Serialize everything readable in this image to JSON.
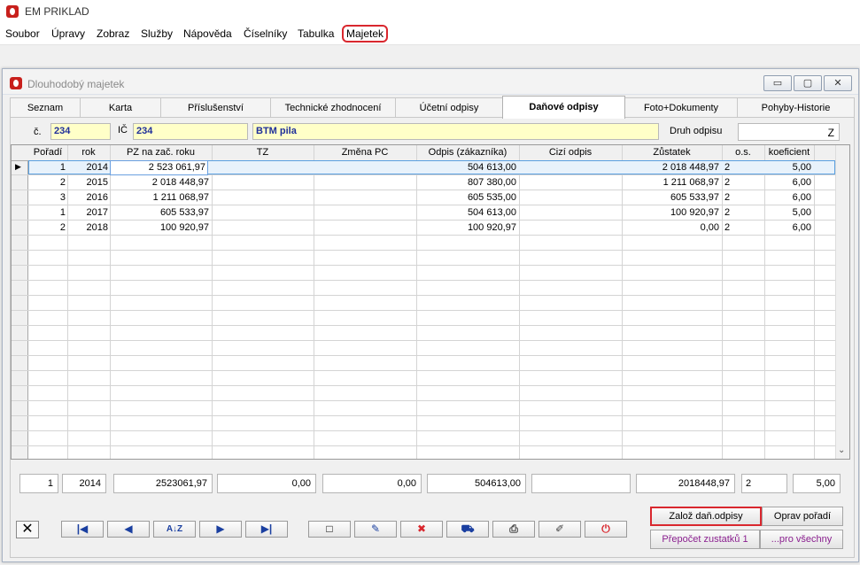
{
  "app": {
    "title": "EM PRIKLAD"
  },
  "menu": [
    "Soubor",
    "Úpravy",
    "Zobraz",
    "Služby",
    "Nápověda",
    "Číselníky",
    "Tabulka",
    "Majetek"
  ],
  "window": {
    "title": "Dlouhodobý majetek",
    "controls": {
      "minimize": "▭",
      "maximize": "▢",
      "close": "✕"
    }
  },
  "tabs": [
    "Seznam",
    "Karta",
    "Příslušenství",
    "Technické zhodnocení",
    "Účetní odpisy",
    "Daňové odpisy",
    "Foto+Dokumenty",
    "Pohyby-Historie"
  ],
  "active_tab": "Daňové odpisy",
  "form": {
    "c_label": "č.",
    "c_value": "234",
    "ic_label": "IČ",
    "ic_value": "234",
    "name_value": "BTM pila",
    "druh_label": "Druh odpisu",
    "druh_value": "Z"
  },
  "table": {
    "columns": [
      "Pořadí",
      "rok",
      "PZ na zač. roku",
      "TZ",
      "Změna PC",
      "Odpis (zákazníka)",
      "Cizí odpis",
      "Zůstatek",
      "o.s.",
      "koeficient"
    ],
    "rows": [
      {
        "poradi": "1",
        "rok": "2014",
        "pz": "2 523 061,97",
        "tz": "",
        "zmena": "",
        "odpis": "504 613,00",
        "cizi": "",
        "zustatek": "2 018 448,97",
        "os": "2",
        "koef": "5,00"
      },
      {
        "poradi": "2",
        "rok": "2015",
        "pz": "2 018 448,97",
        "tz": "",
        "zmena": "",
        "odpis": "807 380,00",
        "cizi": "",
        "zustatek": "1 211 068,97",
        "os": "2",
        "koef": "6,00"
      },
      {
        "poradi": "3",
        "rok": "2016",
        "pz": "1 211 068,97",
        "tz": "",
        "zmena": "",
        "odpis": "605 535,00",
        "cizi": "",
        "zustatek": "605 533,97",
        "os": "2",
        "koef": "6,00"
      },
      {
        "poradi": "1",
        "rok": "2017",
        "pz": "605 533,97",
        "tz": "",
        "zmena": "",
        "odpis": "504 613,00",
        "cizi": "",
        "zustatek": "100 920,97",
        "os": "2",
        "koef": "5,00"
      },
      {
        "poradi": "2",
        "rok": "2018",
        "pz": "100 920,97",
        "tz": "",
        "zmena": "",
        "odpis": "100 920,97",
        "cizi": "",
        "zustatek": "0,00",
        "os": "2",
        "koef": "6,00"
      }
    ]
  },
  "summary": {
    "poradi": "1",
    "rok": "2014",
    "pz": "2523061,97",
    "tz": "0,00",
    "zmena": "0,00",
    "odpis": "504613,00",
    "cizi": "",
    "zustatek": "2018448,97",
    "os": "2",
    "koef": "5,00"
  },
  "nav": {
    "close_glyph": "✕",
    "first_glyph": "|◀",
    "prev_glyph": "◀",
    "sort_glyph": "A↓Z",
    "next_glyph": "▶",
    "last_glyph": "▶|",
    "new_glyph": "□",
    "edit_glyph": "✎",
    "delete_glyph": "✖",
    "view_glyph": "⛟",
    "print_glyph": "⎙",
    "pen_glyph": "✐",
    "power_glyph": "⏻"
  },
  "actions": {
    "zaloz": "Založ daň.odpisy",
    "oprav": "Oprav pořadí",
    "prepocet": "Přepočet zustatků 1",
    "pro_vsechny": "...pro všechny"
  }
}
